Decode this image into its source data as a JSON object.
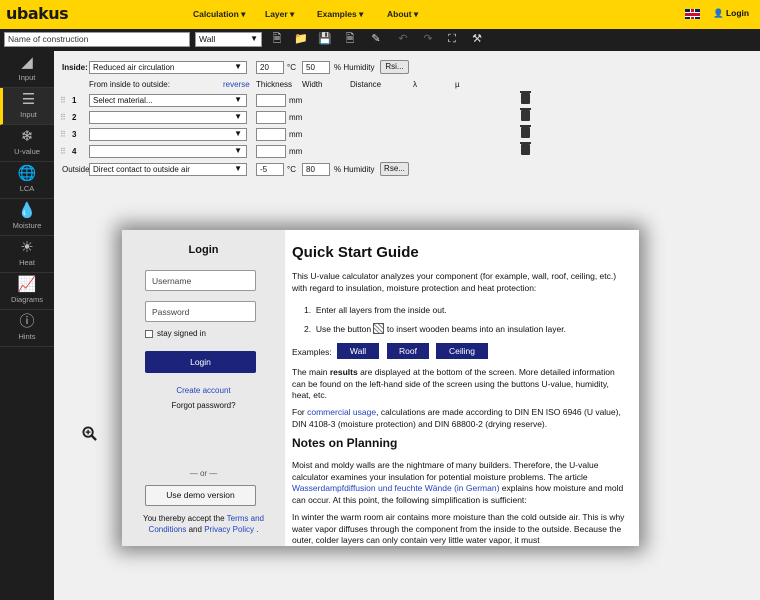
{
  "header": {
    "logo": "ubakus",
    "nav": [
      "Calculation ▾",
      "Layer ▾",
      "Examples ▾",
      "About ▾"
    ],
    "login": "Login"
  },
  "toolbar": {
    "name_placeholder": "Name of construction",
    "type_value": "Wall"
  },
  "sidebar": {
    "items": [
      {
        "label": "Input",
        "icon": "construction-input-icon"
      },
      {
        "label": "Input",
        "icon": "layers-input-icon"
      },
      {
        "label": "U-value",
        "icon": "thermometer-snowflake-icon"
      },
      {
        "label": "LCA",
        "icon": "globe-icon"
      },
      {
        "label": "Moisture",
        "icon": "drop-icon"
      },
      {
        "label": "Heat",
        "icon": "sun-icon"
      },
      {
        "label": "Diagrams",
        "icon": "line-chart-icon"
      },
      {
        "label": "Hints",
        "icon": "exclamation-icon"
      }
    ]
  },
  "form": {
    "inside_label": "Inside:",
    "inside_select": "Reduced air circulation",
    "inside_temp": "20",
    "inside_temp_unit": "°C",
    "inside_humidity": "50",
    "humidity_unit": "% Humidity",
    "inside_button": "Rsi...",
    "from_inside": "From inside to outside:",
    "reverse": "reverse",
    "col_thickness": "Thickness",
    "col_width": "Width",
    "col_distance": "Distance",
    "col_lambda": "λ",
    "col_mu": "µ",
    "rows": [
      {
        "num": "1",
        "material": "Select material...",
        "unit": "mm"
      },
      {
        "num": "2",
        "material": "",
        "unit": "mm"
      },
      {
        "num": "3",
        "material": "",
        "unit": "mm"
      },
      {
        "num": "4",
        "material": "",
        "unit": "mm"
      }
    ],
    "outside_label": "Outside",
    "outside_select": "Direct contact to outside air",
    "outside_temp": "-5",
    "outside_humidity": "80",
    "outside_button": "Rse..."
  },
  "login_panel": {
    "title": "Login",
    "username_placeholder": "Username",
    "password_placeholder": "Password",
    "stay_signed_in": "stay signed in",
    "login_button": "Login",
    "create_account": "Create account",
    "forgot_password": "Forgot password?",
    "or": "— or —",
    "demo_button": "Use demo version",
    "accept_text_1": "You thereby accept the",
    "terms": "Terms and Conditions",
    "and": "and",
    "privacy": "Privacy Policy",
    "dot": "."
  },
  "guide": {
    "title": "Quick Start Guide",
    "intro": "This U-value calculator analyzes your component (for example, wall, roof, ceiling, etc.) with regard to insulation, moisture protection and heat protection:",
    "step1": "Enter all layers from the inside out.",
    "step2a": "Use the button",
    "step2b": "to insert wooden beams into an insulation layer.",
    "examples_label": "Examples:",
    "examples": [
      "Wall",
      "Roof",
      "Ceiling"
    ],
    "results_a": "The main",
    "results_b": "results",
    "results_c": "are displayed at the bottom of the screen. More detailed information can be found on the left-hand side of the screen using the buttons U-value, humidity, heat, etc.",
    "commercial_a": "For",
    "commercial_link": "commercial usage",
    "commercial_b": ", calculations are made according to DIN EN ISO 6946 (U value), DIN 4108-3 (moisture protection) and DIN 68800-2 (drying reserve).",
    "notes_title": "Notes on Planning",
    "notes_p1_a": "Moist and moldy walls are the nightmare of many builders. Therefore, the U-value calculator examines your insulation for potential moisture problems. The article",
    "notes_link": "Wasserdampfdiffusion und feuchte Wände (in German)",
    "notes_p1_b": "explains how moisture and mold can occur. At this point, the following simplification is sufficient:",
    "notes_p2": "In winter the warm room air contains more moisture than the cold outside air. This is why water vapor diffuses through the component from the inside to the outside. Because the outer, colder layers can only contain very little water vapor, it must"
  }
}
